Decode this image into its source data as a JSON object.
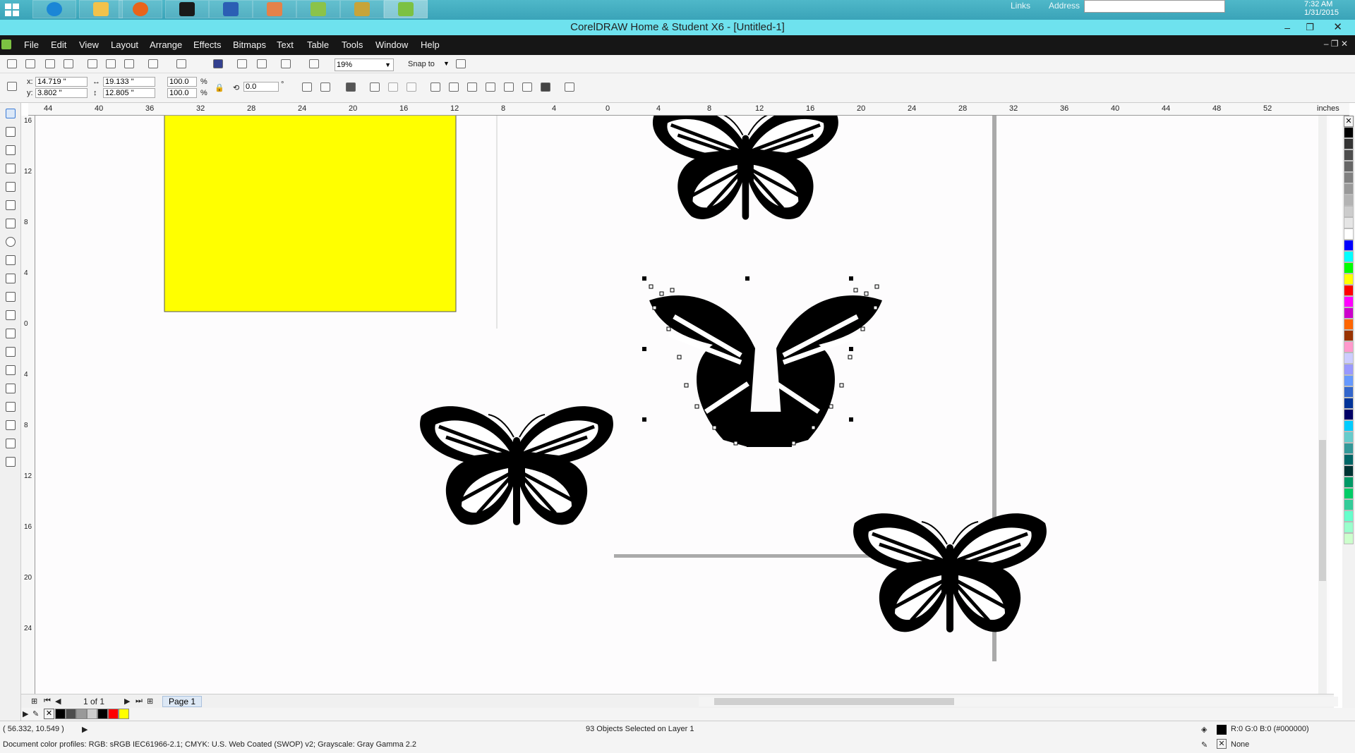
{
  "taskbar": {
    "links": "Links",
    "address": "Address",
    "time": "7:32 AM",
    "date": "1/31/2015"
  },
  "title": "CorelDRAW Home & Student X6 - [Untitled-1]",
  "menu": [
    "File",
    "Edit",
    "View",
    "Layout",
    "Arrange",
    "Effects",
    "Bitmaps",
    "Text",
    "Table",
    "Tools",
    "Window",
    "Help"
  ],
  "toolbar": {
    "zoom": "19%",
    "snap": "Snap to"
  },
  "props": {
    "x": "14.719 \"",
    "y": "3.802 \"",
    "w": "19.133 \"",
    "h": "12.805 \"",
    "sx": "100.0",
    "sy": "100.0",
    "pct": "%",
    "rot": "0.0",
    "deg": "°"
  },
  "ruler": {
    "h": [
      "44",
      "40",
      "36",
      "32",
      "28",
      "24",
      "20",
      "16",
      "12",
      "8",
      "4",
      "0",
      "4",
      "8",
      "12",
      "16",
      "20",
      "24",
      "28",
      "32",
      "36",
      "40",
      "44",
      "48",
      "52"
    ],
    "unit": "inches",
    "v": [
      "16",
      "12",
      "8",
      "4",
      "0",
      "4",
      "8",
      "12",
      "16",
      "20",
      "24"
    ]
  },
  "pages": {
    "count": "1 of 1",
    "tab": "Page 1"
  },
  "status": {
    "coords": "( 56.332, 10.549 )",
    "selection": "93 Objects Selected on Layer 1",
    "fill": "R:0 G:0 B:0 (#000000)",
    "outline": "None",
    "profile": "Document color profiles: RGB: sRGB IEC61966-2.1; CMYK: U.S. Web Coated (SWOP) v2; Grayscale: Gray Gamma 2.2"
  },
  "colors": {
    "yellow": "#ffff00",
    "taskbar": "#3aa3b8",
    "titlebar": "#6ee2ee",
    "menubar": "#161616"
  },
  "palette": [
    "#000000",
    "#333333",
    "#4d4d4d",
    "#666666",
    "#808080",
    "#999999",
    "#b3b3b3",
    "#cccccc",
    "#e5e5e5",
    "#ffffff",
    "#0000ff",
    "#00ffff",
    "#00ff00",
    "#ffff00",
    "#ff0000",
    "#ff00ff",
    "#cc00cc",
    "#ff6600",
    "#993300",
    "#ff99cc",
    "#ccccff",
    "#9999ff",
    "#6699ff",
    "#3366cc",
    "#003399",
    "#000066",
    "#00ccff",
    "#66cccc",
    "#339999",
    "#006666",
    "#003333",
    "#009966",
    "#00cc66",
    "#33cc99",
    "#66ffcc",
    "#99ffcc",
    "#ccffcc"
  ],
  "docpalette": [
    "#000000",
    "#4d4d4d",
    "#999999",
    "#cccccc",
    "#000000",
    "#ff0000",
    "#ffff00"
  ]
}
